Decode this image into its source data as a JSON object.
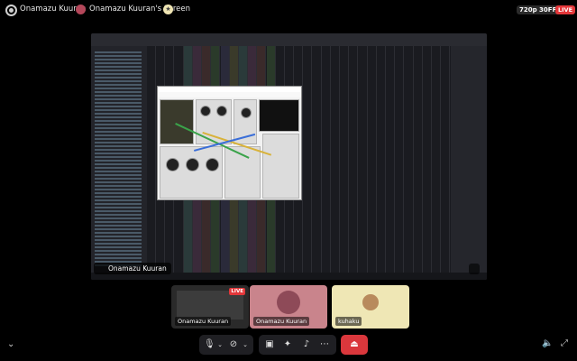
{
  "topbar": {
    "user_name": "Onamazu Kuuran",
    "separator": "·",
    "screen_title": "Onamazu Kuuran's Screen",
    "quality_badge": "720p 30FPS",
    "live_badge": "LIVE"
  },
  "stream": {
    "name_label": "Onamazu Kuuran"
  },
  "participants": [
    {
      "label": "Onamazu Kuuran",
      "live": "LIVE"
    },
    {
      "label": "Onamazu Kuuran"
    },
    {
      "label": "kuhaku"
    }
  ],
  "icons": {
    "settings": "gear-icon",
    "chevron": "chevron-down-icon",
    "mic": "microphone-icon",
    "camera": "camera-off-icon",
    "share": "screen-share-icon",
    "activities": "activities-icon",
    "soundboard": "soundboard-icon",
    "more": "more-icon",
    "leave": "leave-call-icon",
    "volume": "volume-icon",
    "fullscreen": "fullscreen-icon",
    "zoom": "zoom-icon"
  },
  "colors": {
    "accent_live": "#e3373a",
    "leave": "#da373c",
    "tile2_bg": "#c9848c",
    "tile3_bg": "#efe7b5"
  }
}
